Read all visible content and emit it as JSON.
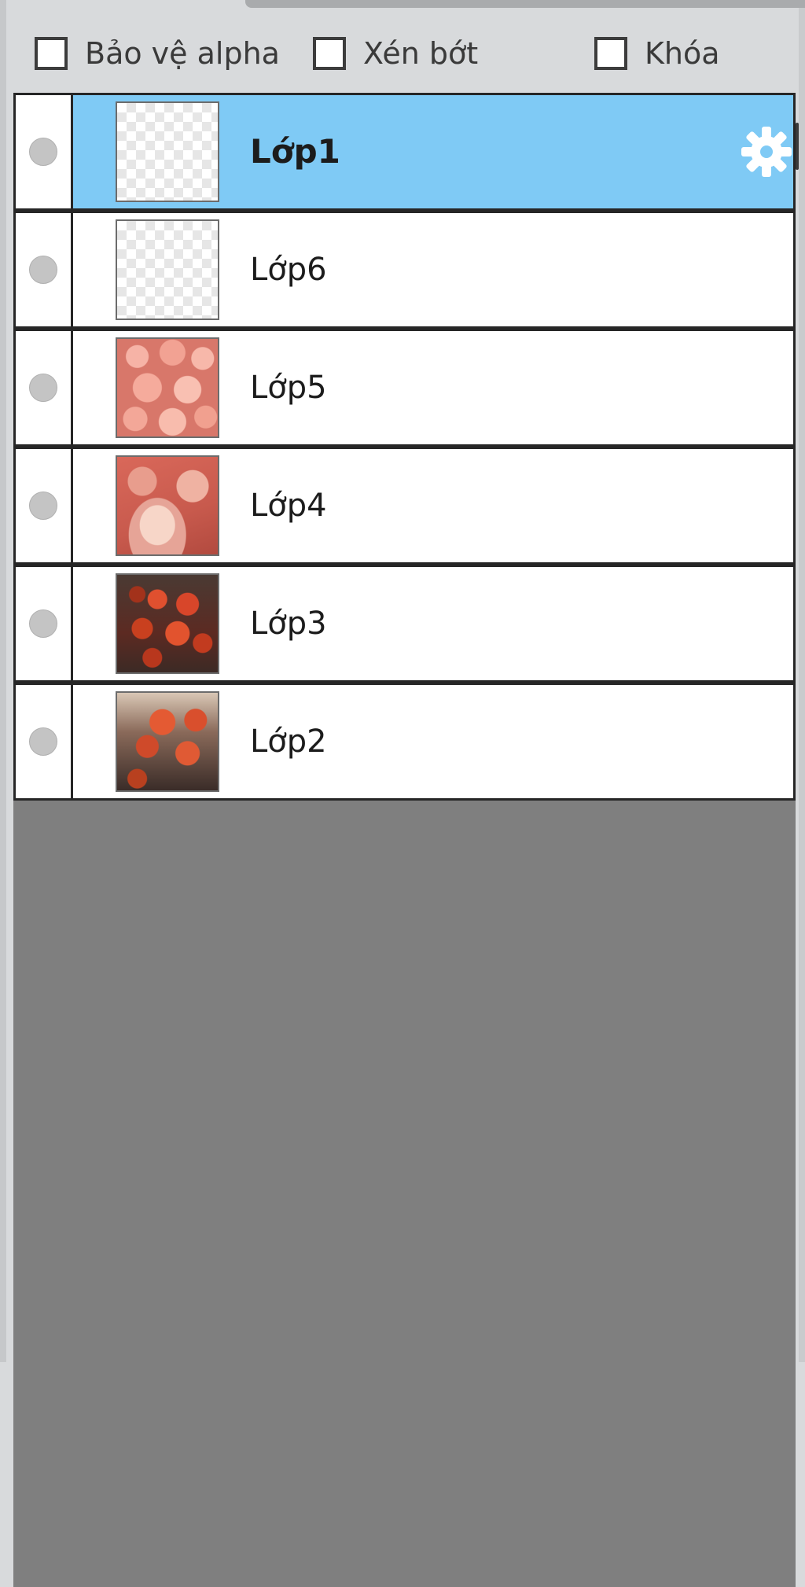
{
  "options": {
    "alpha_protect": {
      "label": "Bảo vệ alpha",
      "checked": false
    },
    "clip": {
      "label": "Xén bớt",
      "checked": false
    },
    "lock": {
      "label": "Khóa",
      "checked": false
    }
  },
  "layers": [
    {
      "name": "Lớp1",
      "selected": true,
      "thumbnail": "transparent-checker"
    },
    {
      "name": "Lớp6",
      "selected": false,
      "thumbnail": "transparent-checker"
    },
    {
      "name": "Lớp5",
      "selected": false,
      "thumbnail": "peaches"
    },
    {
      "name": "Lớp4",
      "selected": false,
      "thumbnail": "cups"
    },
    {
      "name": "Lớp3",
      "selected": false,
      "thumbnail": "roses"
    },
    {
      "name": "Lớp2",
      "selected": false,
      "thumbnail": "roses"
    }
  ],
  "icons": {
    "visibility": "visibility-dot-icon",
    "settings": "gear-icon"
  },
  "colors": {
    "selected_row": "#7fcaf5",
    "list_background": "#7f7f7f",
    "panel_background": "#d8dadc"
  }
}
